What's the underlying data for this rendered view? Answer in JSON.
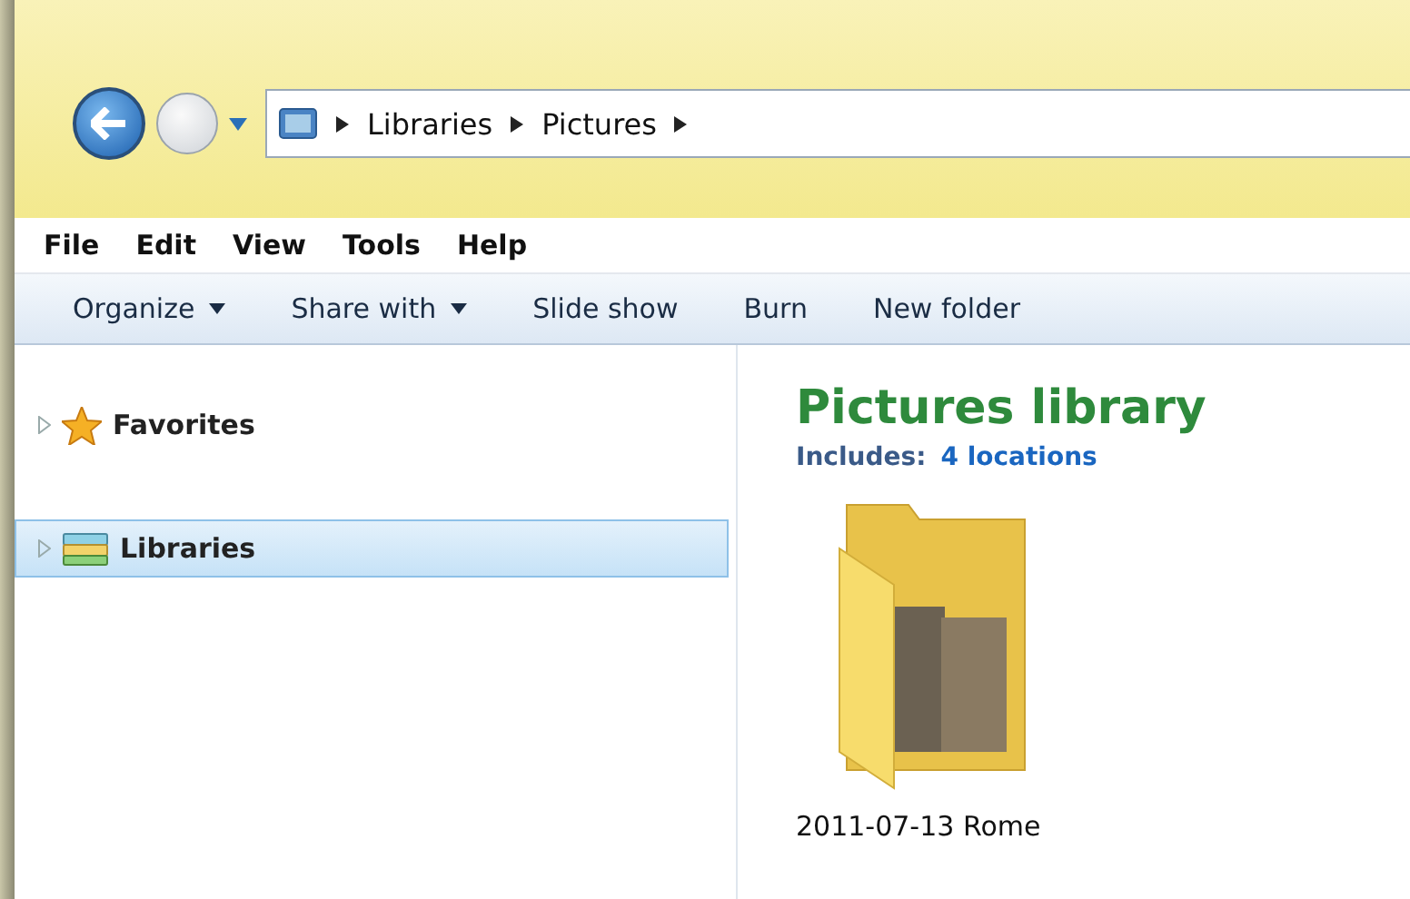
{
  "address_bar": {
    "segments": [
      "Libraries",
      "Pictures"
    ]
  },
  "menu_bar": [
    "File",
    "Edit",
    "View",
    "Tools",
    "Help"
  ],
  "toolbar": [
    {
      "label": "Organize",
      "dropdown": true
    },
    {
      "label": "Share with",
      "dropdown": true
    },
    {
      "label": "Slide show",
      "dropdown": false
    },
    {
      "label": "Burn",
      "dropdown": false
    },
    {
      "label": "New folder",
      "dropdown": false
    }
  ],
  "navigation_pane": {
    "items": [
      {
        "label": "Favorites",
        "kind": "favorites",
        "selected": false,
        "expanded": false
      },
      {
        "label": "Libraries",
        "kind": "libraries",
        "selected": true,
        "expanded": false
      }
    ]
  },
  "library": {
    "title": "Pictures library",
    "includes_label": "Includes:",
    "locations_link": "4 locations"
  },
  "items": [
    {
      "name": "2011-07-13 Rome"
    }
  ]
}
